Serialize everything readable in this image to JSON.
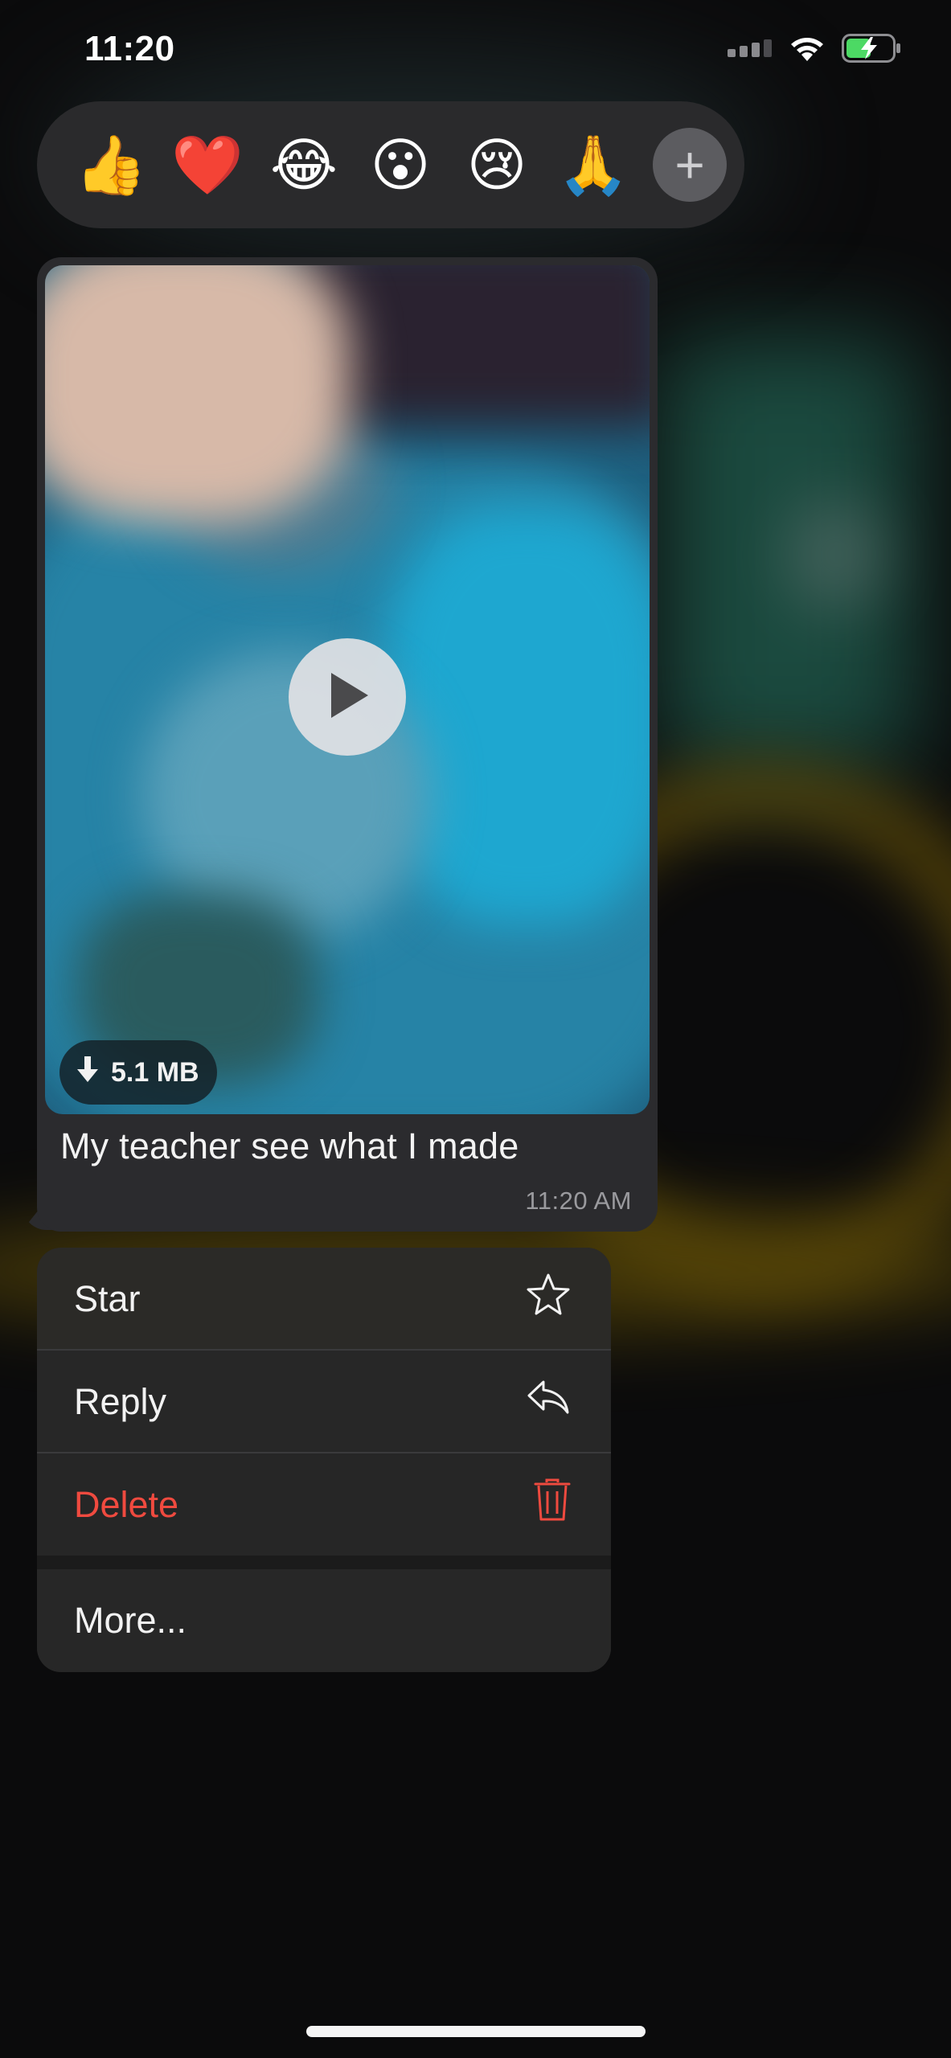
{
  "status_bar": {
    "time": "11:20"
  },
  "reactions": {
    "items": [
      "👍",
      "❤️",
      "😂",
      "😮",
      "😢",
      "🙏"
    ],
    "add_label": "+"
  },
  "message": {
    "video_size": "5.1 MB",
    "caption": "My teacher see what I made",
    "time": "11:20 AM"
  },
  "menu": {
    "star_label": "Star",
    "reply_label": "Reply",
    "delete_label": "Delete",
    "more_label": "More...",
    "delete_color": "#ef4a3f"
  },
  "icons": {
    "signal": "cellular-signal-icon",
    "wifi": "wifi-icon",
    "battery": "battery-charging-icon",
    "play": "play-icon",
    "download": "download-arrow-icon",
    "star": "star-outline-icon",
    "reply": "reply-arrow-icon",
    "delete": "trash-icon"
  }
}
